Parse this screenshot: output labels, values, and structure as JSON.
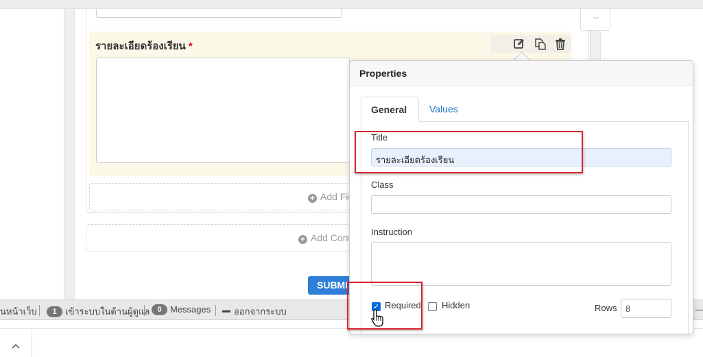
{
  "form": {
    "field_label": "รายละเอียดร้องเรียน",
    "required_mark": "*",
    "add_field_label": "Add Fie",
    "add_container_label": "Add Conta",
    "submit_label": "SUBMI"
  },
  "field_toolbar": {
    "icons": [
      "edit-icon",
      "copy-icon",
      "trash-icon"
    ]
  },
  "properties": {
    "title": "Properties",
    "tabs": [
      {
        "label": "General",
        "active": true
      },
      {
        "label": "Values",
        "active": false
      }
    ],
    "title_label": "Title",
    "title_value": "รายละเอียดร้องเรียน",
    "class_label": "Class",
    "class_value": "",
    "instruction_label": "Instruction",
    "required_label": "Required",
    "required_checked": true,
    "hidden_label": "Hidden",
    "hidden_checked": false,
    "rows_label": "Rows",
    "rows_value": "8"
  },
  "admin_bar": {
    "site_link": "นหน้าเว็บ",
    "notifications_count": "1",
    "notifications_label": "เข้าระบบในด้านผู้ดูแล",
    "messages_count": "0",
    "messages_label": "Messages",
    "logout_label": "ออกจากระบบ"
  },
  "colors": {
    "accent": "#2f7ed8",
    "link": "#1a73c8",
    "required": "#d0021b",
    "highlight": "#d9232e",
    "field_bg": "#fcf8e8"
  }
}
